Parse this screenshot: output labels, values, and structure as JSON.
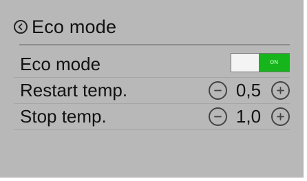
{
  "header": {
    "title": "Eco mode"
  },
  "rows": [
    {
      "label": "Eco mode",
      "toggle": {
        "state_label": "ON"
      }
    },
    {
      "label": "Restart temp.",
      "value": "0,5"
    },
    {
      "label": "Stop temp.",
      "value": "1,0"
    }
  ],
  "colors": {
    "background": "#b8b8b8",
    "toggle_on": "#16b51b",
    "text": "#111111"
  },
  "icons": {
    "back": "chevron-left-circle-icon",
    "minus": "minus-circle-icon",
    "plus": "plus-circle-icon"
  }
}
